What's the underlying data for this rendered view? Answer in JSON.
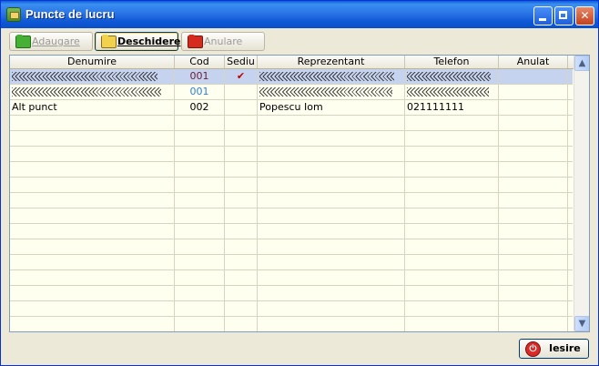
{
  "window": {
    "title": "Puncte de lucru",
    "app_icon": "folders-icon"
  },
  "toolbar": {
    "add_label": "Adaugare",
    "open_label": "Deschidere",
    "cancel_label": "Anulare"
  },
  "table": {
    "columns": [
      "Denumire",
      "Cod",
      "Sediu",
      "Reprezentant",
      "Telefon",
      "Anulat"
    ],
    "rows": [
      {
        "denumire": "",
        "cod": "001",
        "sediu": "✔",
        "reprezentant": "",
        "telefon": "",
        "anulat": ""
      },
      {
        "denumire": "",
        "cod": "001",
        "sediu": "",
        "reprezentant": "",
        "telefon": "",
        "anulat": ""
      },
      {
        "denumire": "Alt punct",
        "cod": "002",
        "sediu": "",
        "reprezentant": "Popescu Iom",
        "telefon": "021111111",
        "anulat": ""
      }
    ]
  },
  "footer": {
    "exit_label": "Iesire"
  },
  "colors": {
    "title_bar": "#2b74e6",
    "selected_row": "#c6d3ee",
    "grid_bg": "#fffff0",
    "cod_maroon": "#6d1a36",
    "cod_blue": "#2f7fd0",
    "check": "#c00000"
  }
}
